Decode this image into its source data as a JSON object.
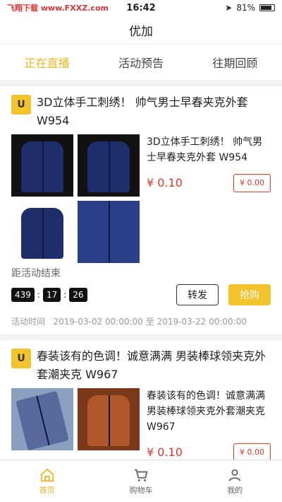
{
  "status": {
    "watermark": "飞翔下载 www.FXXZ.com",
    "time": "16:42",
    "battery": "81%"
  },
  "header": {
    "title": "优加"
  },
  "tabs": [
    {
      "label": "正在直播"
    },
    {
      "label": "活动预告"
    },
    {
      "label": "往期回顾"
    }
  ],
  "cards": [
    {
      "logo": "U",
      "title": "3D立体手工刺绣！ 帅气男士早春夹克外套W954",
      "desc": "3D立体手工刺绣！ 帅气男士早春夹克外套 W954",
      "price": "¥ 0.10",
      "tag": "¥ 0.00",
      "countdown_label": "距活动结束",
      "countdown": [
        "439",
        "17",
        "26"
      ],
      "share_label": "转发",
      "buy_label": "抢购",
      "time_label": "活动时间",
      "time_value": "2019-03-02 00:00:00 至 2019-03-22 00:00:00"
    },
    {
      "logo": "U",
      "title": "春装该有的色调！诚意满满 男装棒球领夹克外套潮夹克 W967",
      "desc": "春装该有的色调！诚意满满男装棒球领夹克外套潮夹克 W967",
      "price": "¥ 0.10",
      "tag": "¥ 0.00"
    }
  ],
  "bottom_nav": [
    {
      "label": "首页",
      "icon": "home-icon"
    },
    {
      "label": "购物车",
      "icon": "cart-icon"
    },
    {
      "label": "我的",
      "icon": "user-icon"
    }
  ],
  "colors": {
    "accent": "#f0b51c",
    "price": "#e53a2a"
  }
}
